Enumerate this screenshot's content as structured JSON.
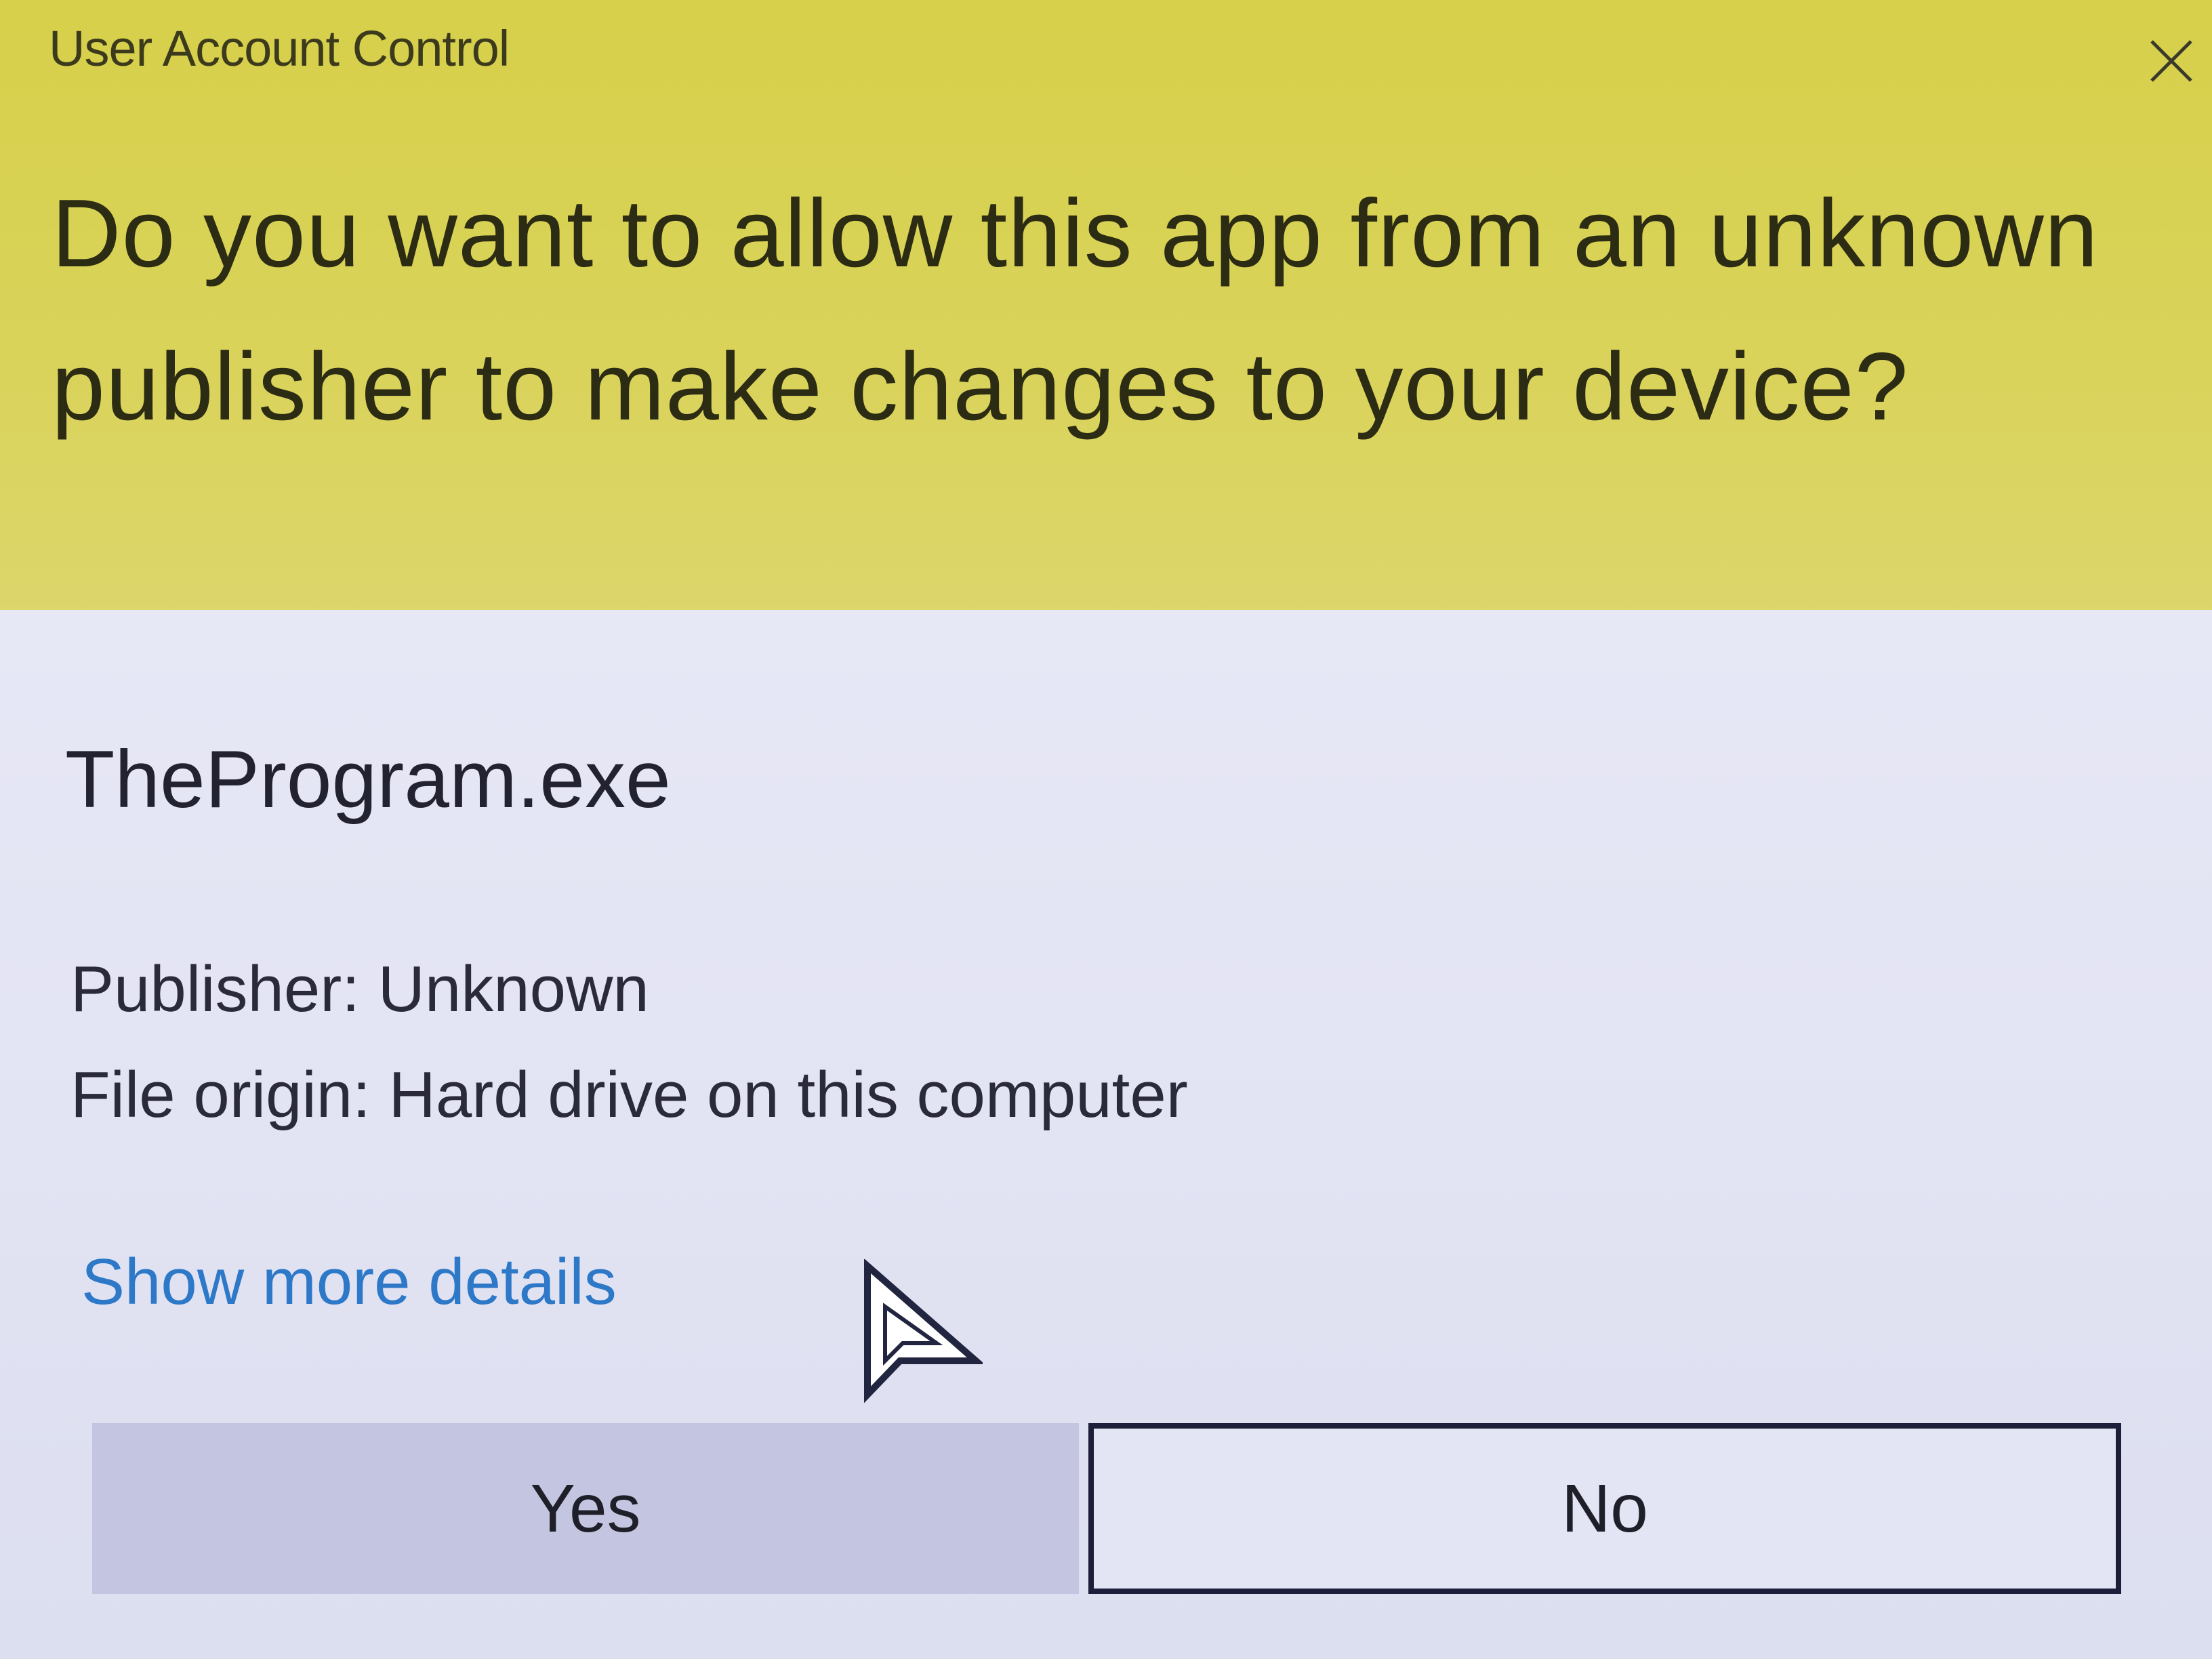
{
  "dialog": {
    "title": "User Account Control",
    "question": "Do you want to allow this app from an unknown publisher to make changes to your device?",
    "program_name": "TheProgram.exe",
    "publisher": "Publisher: Unknown",
    "file_origin": "File origin: Hard drive on this computer",
    "details_link": "Show more details",
    "yes_label": "Yes",
    "no_label": "No",
    "colors": {
      "header_bg": "#d7d04a",
      "body_bg": "#e3e4f3",
      "link": "#2e78c8",
      "yes_bg": "#c4c5e0",
      "no_border": "#1d1f3a"
    },
    "icons": [
      "close-icon",
      "mouse-pointer-icon"
    ]
  }
}
